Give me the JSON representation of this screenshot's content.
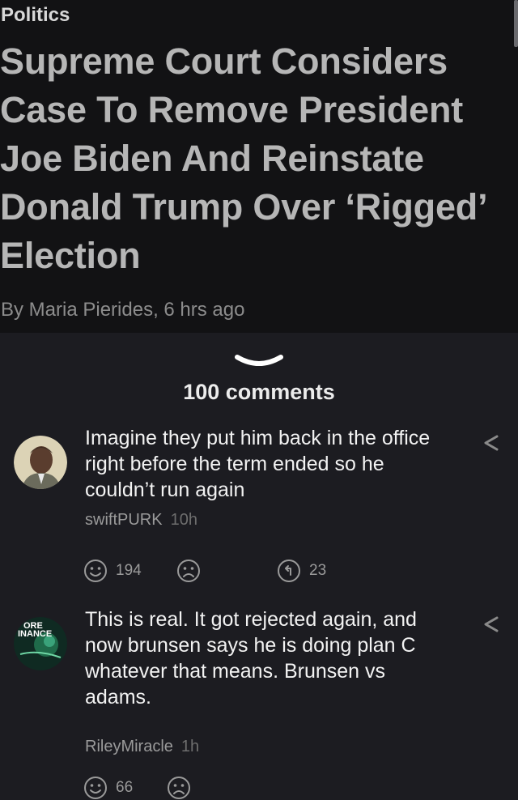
{
  "article": {
    "category": "Politics",
    "headline": "Supreme Court Considers Case To Remove President Joe Biden And Reinstate Donald Trump Over ‘Rigged’ Election",
    "byline": "By Maria Pierides, 6 hrs ago"
  },
  "comments_header": {
    "count_label": "100 comments"
  },
  "comments": [
    {
      "text": "Imagine they put him back in the office right before the term ended so he couldn’t run again",
      "author": "swiftPURK",
      "time": "10h",
      "smile_count": "194",
      "reply_count": "23"
    },
    {
      "text": "This is real. It got rejected again, and now brunsen says he is doing plan C whatever that means. Brunsen vs adams.",
      "author": "RileyMiracle",
      "time": "1h",
      "smile_count": "66",
      "avatar_text": "ORE INANCE"
    }
  ],
  "icons": {
    "chevron": "chevron-down-icon",
    "share": "share-icon",
    "smile": "smile-icon",
    "frown": "frown-icon",
    "reply": "reply-icon"
  }
}
